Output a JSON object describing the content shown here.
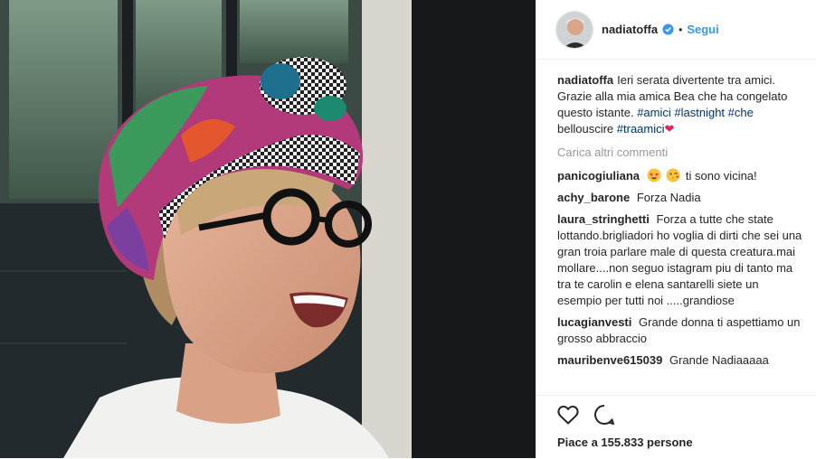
{
  "post": {
    "username": "nadiatoffa",
    "follow_label": "Segui",
    "dot": "•",
    "caption": {
      "username": "nadiatoffa",
      "text": "Ieri serata divertente tra amici. Grazie alla mia amica Bea che ha congelato questo istante.",
      "tags": [
        "#amici",
        "#lastnight",
        "#che",
        "#traamici"
      ],
      "between_tags_text": "bellouscire",
      "heart": "❤"
    },
    "load_more": "Carica altri commenti",
    "comments": [
      {
        "user": "panicogiuliana",
        "text": "ti sono vicina!"
      },
      {
        "user": "achy_barone",
        "text": "Forza Nadia"
      },
      {
        "user": "laura_stringhetti",
        "text": "Forza a tutte che state lottando.brigliadori ho voglia di dirti che sei una gran troia parlare male di questa creatura.mai mollare....non seguo istagram piu di tanto ma tra te carolin e elena santarelli siete un esempio per tutti noi .....grandiose"
      },
      {
        "user": "lucagianvesti",
        "text": "Grande donna ti aspettiamo un grosso abbraccio"
      },
      {
        "user": "mauribenve615039",
        "text": "Grande Nadiaaaaa"
      }
    ],
    "likes": "Piace a 155.833 persone",
    "colors": {
      "link": "#3897f0",
      "tag": "#003569",
      "muted": "#999999",
      "heart": "#e0245e"
    }
  }
}
